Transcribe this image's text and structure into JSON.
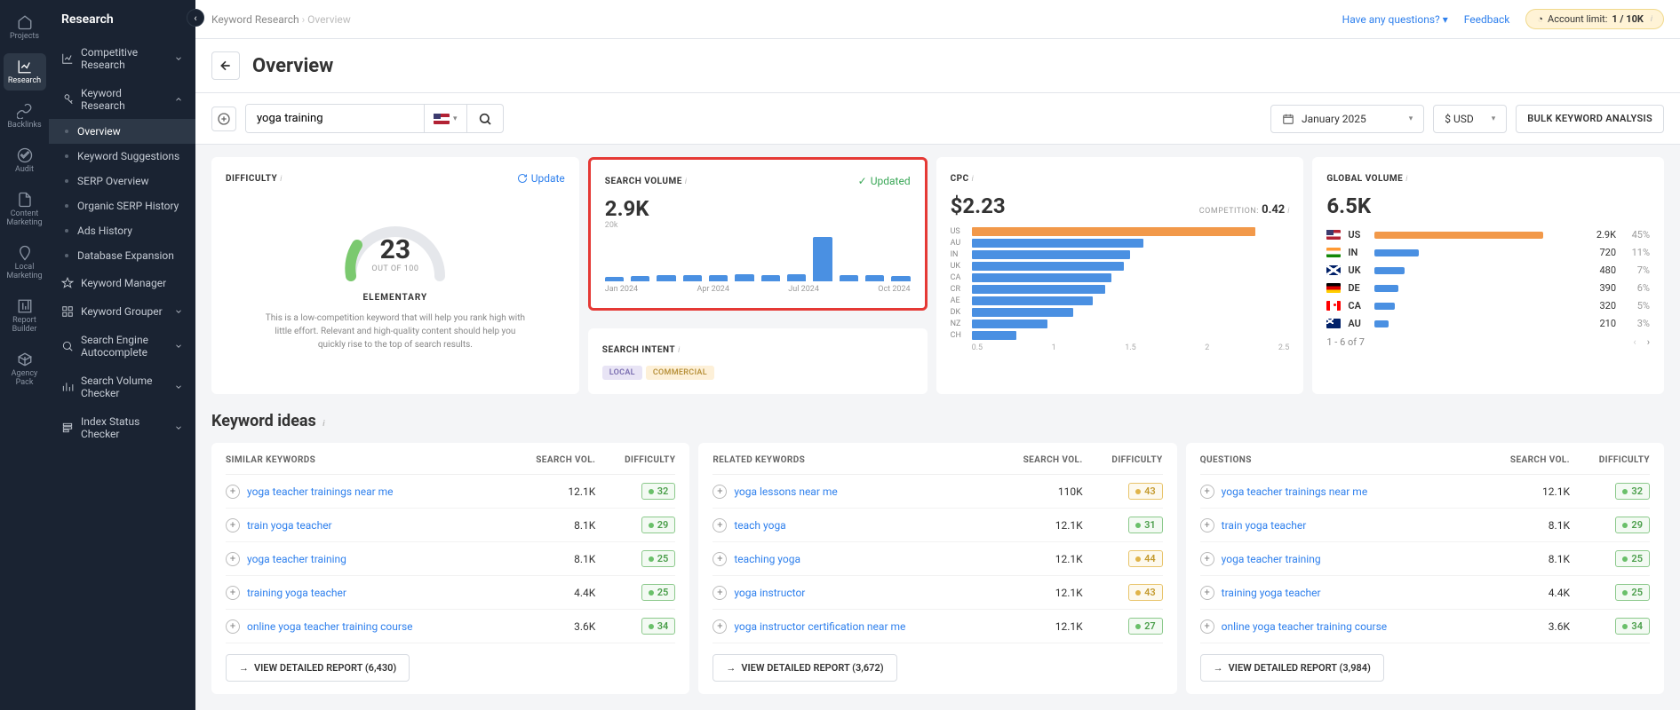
{
  "iconbar": [
    {
      "label": "Projects",
      "icon": "home"
    },
    {
      "label": "Research",
      "icon": "analytics",
      "active": true
    },
    {
      "label": "Backlinks",
      "icon": "link"
    },
    {
      "label": "Audit",
      "icon": "check"
    },
    {
      "label": "Content Marketing",
      "icon": "doc"
    },
    {
      "label": "Local Marketing",
      "icon": "pin"
    },
    {
      "label": "Report Builder",
      "icon": "report"
    },
    {
      "label": "Agency Pack",
      "icon": "pack"
    }
  ],
  "sidebar": {
    "title": "Research",
    "groups": [
      {
        "label": "Competitive Research",
        "icon": "chart",
        "expandable": true
      },
      {
        "label": "Keyword Research",
        "icon": "key",
        "expanded": true,
        "children": [
          {
            "label": "Overview",
            "active": true
          },
          {
            "label": "Keyword Suggestions"
          },
          {
            "label": "SERP Overview"
          },
          {
            "label": "Organic SERP History"
          },
          {
            "label": "Ads History"
          },
          {
            "label": "Database Expansion"
          }
        ]
      },
      {
        "label": "Keyword Manager",
        "icon": "star"
      },
      {
        "label": "Keyword Grouper",
        "icon": "group",
        "expandable": true
      },
      {
        "label": "Search Engine Autocomplete",
        "icon": "search",
        "expandable": true
      },
      {
        "label": "Search Volume Checker",
        "icon": "bars",
        "expandable": true
      },
      {
        "label": "Index Status Checker",
        "icon": "index",
        "expandable": true
      }
    ]
  },
  "breadcrumb": {
    "a": "Keyword Research",
    "b": "Overview"
  },
  "topbar": {
    "questions": "Have any questions?",
    "feedback": "Feedback",
    "limit_label": "Account limit:",
    "limit_val": "1 / 10K"
  },
  "page_title": "Overview",
  "search": {
    "value": "yoga training",
    "country": "US"
  },
  "controls": {
    "date": "January 2025",
    "currency": "$ USD",
    "bulk": "BULK KEYWORD ANALYSIS"
  },
  "difficulty": {
    "title": "DIFFICULTY",
    "update": "Update",
    "score": "23",
    "out_of": "OUT OF 100",
    "level": "ELEMENTARY",
    "desc": "This is a low-competition keyword that will help you rank high with little effort. Relevant and high-quality content should help you quickly rise to the top of search results."
  },
  "search_volume": {
    "title": "SEARCH VOLUME",
    "status": "Updated",
    "value": "2.9K",
    "yaxis": "20k"
  },
  "search_intent": {
    "title": "SEARCH INTENT",
    "tags": [
      "LOCAL",
      "COMMERCIAL"
    ]
  },
  "cpc": {
    "title": "CPC",
    "value": "$2.23",
    "comp_label": "COMPETITION:",
    "comp_val": "0.42"
  },
  "global": {
    "title": "GLOBAL VOLUME",
    "value": "6.5K",
    "pager": "1 - 6 of 7"
  },
  "chart_data": {
    "search_volume_trend": {
      "type": "bar",
      "ylabel": "",
      "ylim": [
        0,
        20000
      ],
      "title": "",
      "categories": [
        "Jan 2024",
        "Feb 2024",
        "Mar 2024",
        "Apr 2024",
        "May 2024",
        "Jun 2024",
        "Jul 2024",
        "Aug 2024",
        "Sep 2024",
        "Oct 2024",
        "Nov 2024",
        "Dec 2024"
      ],
      "values": [
        1500,
        1800,
        2000,
        2000,
        2200,
        2300,
        2200,
        2400,
        15000,
        2200,
        2000,
        1900
      ],
      "x_ticks_shown": [
        "Jan 2024",
        "Apr 2024",
        "Jul 2024",
        "Oct 2024"
      ]
    },
    "cpc_by_country": {
      "type": "bar",
      "orientation": "horizontal",
      "xlim": [
        0,
        2.5
      ],
      "x_ticks": [
        0.5,
        1,
        1.5,
        2,
        2.5
      ],
      "categories": [
        "US",
        "AU",
        "IN",
        "UK",
        "CA",
        "CR",
        "AE",
        "DK",
        "NZ",
        "CH"
      ],
      "values": [
        2.23,
        1.35,
        1.25,
        1.2,
        1.1,
        1.05,
        0.95,
        0.8,
        0.6,
        0.35
      ],
      "highlight_index": 0
    },
    "global_volume_by_country": {
      "type": "bar",
      "orientation": "horizontal",
      "series": [
        {
          "cc": "US",
          "value": "2.9K",
          "pct": "45%",
          "bar": 85,
          "color": "#f2994a"
        },
        {
          "cc": "IN",
          "value": "720",
          "pct": "11%",
          "bar": 22,
          "color": "#4a90e2"
        },
        {
          "cc": "UK",
          "value": "480",
          "pct": "7%",
          "bar": 15,
          "color": "#4a90e2"
        },
        {
          "cc": "DE",
          "value": "390",
          "pct": "6%",
          "bar": 12,
          "color": "#4a90e2"
        },
        {
          "cc": "CA",
          "value": "320",
          "pct": "5%",
          "bar": 10,
          "color": "#4a90e2"
        },
        {
          "cc": "AU",
          "value": "210",
          "pct": "3%",
          "bar": 7,
          "color": "#4a90e2"
        }
      ]
    }
  },
  "ideas": {
    "title": "Keyword ideas",
    "headers": {
      "similar": "SIMILAR KEYWORDS",
      "related": "RELATED KEYWORDS",
      "questions": "QUESTIONS",
      "sv": "SEARCH VOL.",
      "diff": "DIFFICULTY"
    },
    "similar": [
      {
        "kw": "yoga teacher trainings near me",
        "sv": "12.1K",
        "diff": 32,
        "cls": "green"
      },
      {
        "kw": "train yoga teacher",
        "sv": "8.1K",
        "diff": 29,
        "cls": "green"
      },
      {
        "kw": "yoga teacher training",
        "sv": "8.1K",
        "diff": 25,
        "cls": "green"
      },
      {
        "kw": "training yoga teacher",
        "sv": "4.4K",
        "diff": 25,
        "cls": "green"
      },
      {
        "kw": "online yoga teacher training course",
        "sv": "3.6K",
        "diff": 34,
        "cls": "green"
      }
    ],
    "related": [
      {
        "kw": "yoga lessons near me",
        "sv": "110K",
        "diff": 43,
        "cls": "yellow"
      },
      {
        "kw": "teach yoga",
        "sv": "12.1K",
        "diff": 31,
        "cls": "green"
      },
      {
        "kw": "teaching yoga",
        "sv": "12.1K",
        "diff": 44,
        "cls": "yellow"
      },
      {
        "kw": "yoga instructor",
        "sv": "12.1K",
        "diff": 43,
        "cls": "yellow"
      },
      {
        "kw": "yoga instructor certification near me",
        "sv": "12.1K",
        "diff": 27,
        "cls": "green"
      }
    ],
    "questions": [
      {
        "kw": "yoga teacher trainings near me",
        "sv": "12.1K",
        "diff": 32,
        "cls": "green"
      },
      {
        "kw": "train yoga teacher",
        "sv": "8.1K",
        "diff": 29,
        "cls": "green"
      },
      {
        "kw": "yoga teacher training",
        "sv": "8.1K",
        "diff": 25,
        "cls": "green"
      },
      {
        "kw": "training yoga teacher",
        "sv": "4.4K",
        "diff": 25,
        "cls": "green"
      },
      {
        "kw": "online yoga teacher training course",
        "sv": "3.6K",
        "diff": 34,
        "cls": "green"
      }
    ],
    "detail": {
      "similar": "VIEW DETAILED REPORT (6,430)",
      "related": "VIEW DETAILED REPORT (3,672)",
      "questions": "VIEW DETAILED REPORT (3,984)"
    }
  }
}
